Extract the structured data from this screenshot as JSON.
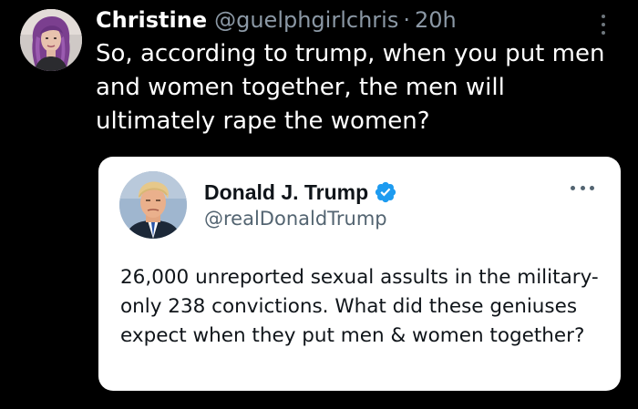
{
  "tweet": {
    "author": {
      "display_name": "Christine",
      "handle": "@guelphgirlchris",
      "separator": "·",
      "time": "20h",
      "avatar_icon": "user-avatar-purple-hair"
    },
    "text": "So, according to trump, when you put men and women together, the men will ultimately rape the women?",
    "more_icon": "more-vertical-icon"
  },
  "quoted_tweet": {
    "author": {
      "display_name": "Donald J. Trump",
      "handle": "@realDonaldTrump",
      "verified": true,
      "avatar_icon": "user-avatar-portrait"
    },
    "text": "26,000 unreported sexual assults in the military-only 238 convictions. What did these geniuses expect when they put men & women together?",
    "more_icon": "more-horizontal-icon"
  },
  "colors": {
    "background": "#000000",
    "primary_text": "#ffffff",
    "secondary_text": "#8b98a5",
    "card_background": "#ffffff",
    "card_text": "#0f1419",
    "card_secondary_text": "#536471",
    "verified_blue": "#1d9bf0"
  }
}
